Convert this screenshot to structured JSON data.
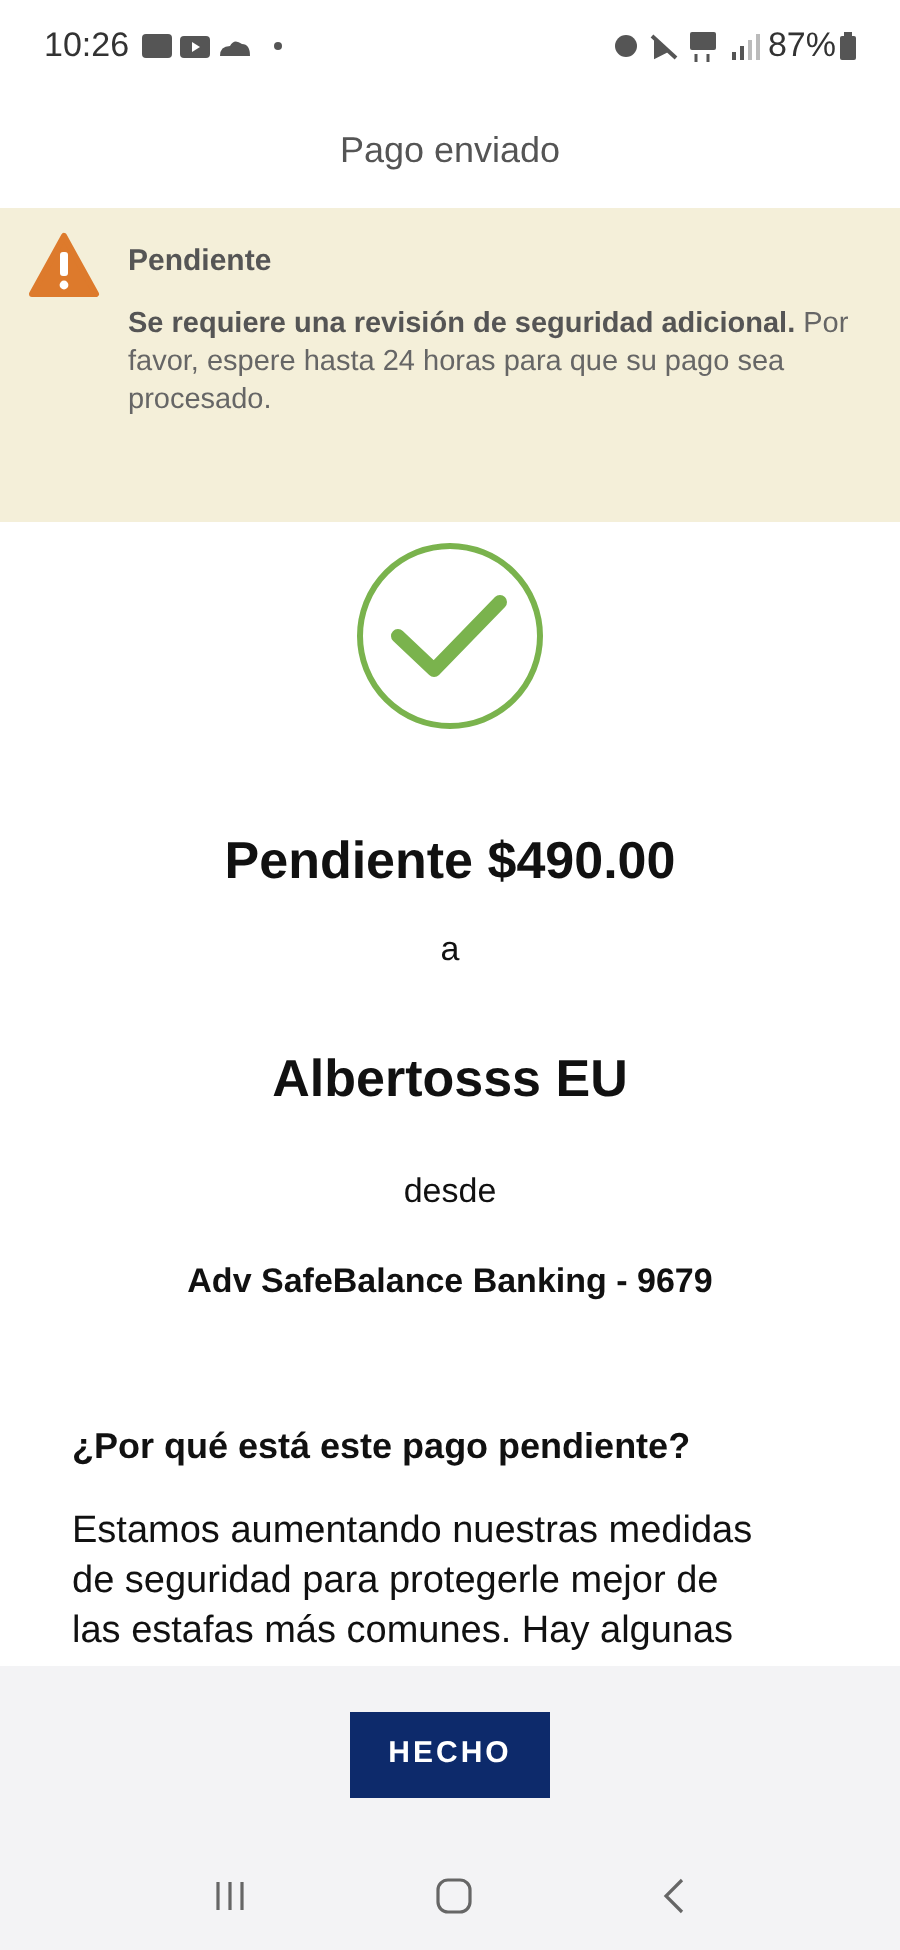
{
  "status_bar": {
    "time": "10:26",
    "battery": "87%"
  },
  "header": {
    "title": "Pago enviado"
  },
  "alert": {
    "title": "Pendiente",
    "message": "**Se requiere una revisión de seguridad adicional.** Por favor, espere hasta 24 horas para que su pago sea procesado."
  },
  "summary": {
    "amount": "Pendiente $490.00",
    "to_label": "a",
    "recipient": "Albertosss EU",
    "from_label": "desde",
    "account": "Adv SafeBalance Banking - 9679"
  },
  "info": {
    "question": "¿Por qué está este pago pendiente?",
    "paragraph": "Estamos aumentando nuestras medidas de seguridad para protegerle mejor de las estafas más comunes. Hay algunas"
  },
  "footer": {
    "button": "HECHO"
  }
}
